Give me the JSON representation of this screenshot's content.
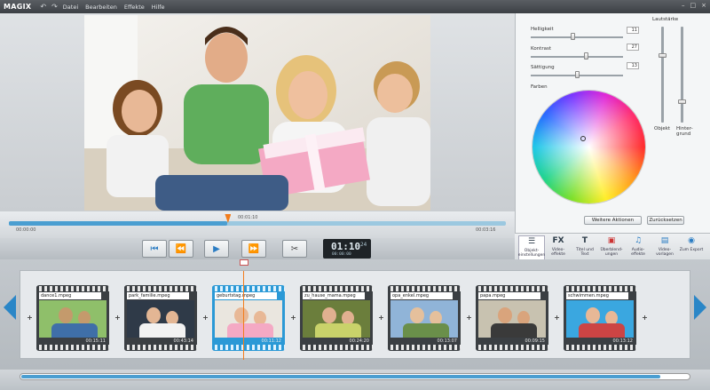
{
  "app": {
    "logo": "MAGIX"
  },
  "menu": [
    "Datei",
    "Bearbeiten",
    "Effekte",
    "Hilfe"
  ],
  "timeline": {
    "start": "00:00:00",
    "current": "00:01:10",
    "end": "00:03:16",
    "progress": 0.44
  },
  "time_display": {
    "main": "01:10",
    "frames": "24",
    "sub": "00:00:00"
  },
  "panel": {
    "sliders": [
      {
        "label": "Helligkeit",
        "value": "11",
        "level": 0.45
      },
      {
        "label": "Kontrast",
        "value": "27",
        "level": 0.6
      },
      {
        "label": "Sättigung",
        "value": "13",
        "level": 0.5
      }
    ],
    "farben_label": "Farben",
    "lautstaerke_label": "Lautstärke",
    "objekt_label": "Objekt",
    "hintergrund_label": "Hinter-grund",
    "button_weitere": "Weitere Aktionen",
    "button_zuruecksetzen": "Zurücksetzen"
  },
  "tabs": [
    {
      "label": "Objekt-einstellungen",
      "icon": "sliders-icon"
    },
    {
      "label": "Video-effekte",
      "icon": "fx-icon"
    },
    {
      "label": "Titel und Text",
      "icon": "title-icon"
    },
    {
      "label": "Überblend-ungen",
      "icon": "transition-icon"
    },
    {
      "label": "Audio-effekte",
      "icon": "audio-icon"
    },
    {
      "label": "Video-vorlagen",
      "icon": "template-icon"
    },
    {
      "label": "Zum Export",
      "icon": "export-icon"
    }
  ],
  "clips": [
    {
      "name": "dance1.mpeg",
      "duration": "00:15:11"
    },
    {
      "name": "park_familie.mpeg",
      "duration": "00:43:14"
    },
    {
      "name": "geburtstag.mpeg",
      "duration": "00:11:12"
    },
    {
      "name": "zu_hause_mama.mpeg",
      "duration": "00:24:20"
    },
    {
      "name": "opa_enkel.mpeg",
      "duration": "00:13:07"
    },
    {
      "name": "papa.mpeg",
      "duration": "00:09:15"
    },
    {
      "name": "schwimmen.mpeg",
      "duration": "00:13:12"
    }
  ],
  "colors": {
    "accent": "#2b99d6",
    "playhead": "#f27d1d"
  }
}
